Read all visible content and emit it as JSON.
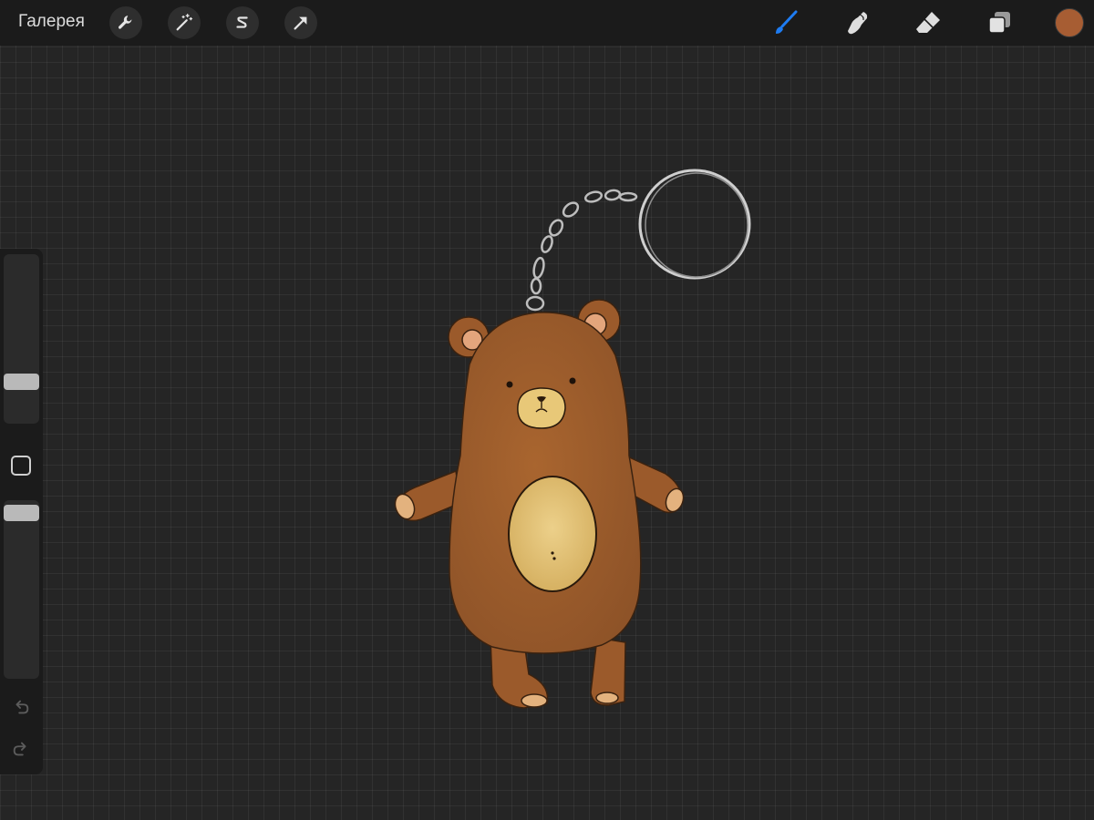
{
  "toolbar": {
    "gallery_label": "Галерея",
    "left_tools": [
      {
        "name": "actions",
        "icon": "wrench-icon"
      },
      {
        "name": "adjustments",
        "icon": "magic-wand-icon"
      },
      {
        "name": "selection",
        "icon": "selection-s-icon"
      },
      {
        "name": "transform",
        "icon": "arrow-cursor-icon"
      }
    ],
    "right_tools": [
      {
        "name": "brush",
        "icon": "brush-icon",
        "active": true
      },
      {
        "name": "smudge",
        "icon": "smudge-finger-icon",
        "active": false
      },
      {
        "name": "eraser",
        "icon": "eraser-icon",
        "active": false
      },
      {
        "name": "layers",
        "icon": "layers-icon",
        "active": false
      }
    ],
    "current_color": "#a75d33"
  },
  "sidebar": {
    "brush_size_level": 0.22,
    "opacity_level": 0.97,
    "modify_icon": "square-modify-icon",
    "undo_icon": "undo-icon",
    "redo_icon": "redo-icon"
  },
  "colors": {
    "accent_active_tool": "#1e7cf2",
    "bear_fur": "#9c5b2c",
    "bear_belly": "#e5c377",
    "chain": "#c8c8c8"
  }
}
